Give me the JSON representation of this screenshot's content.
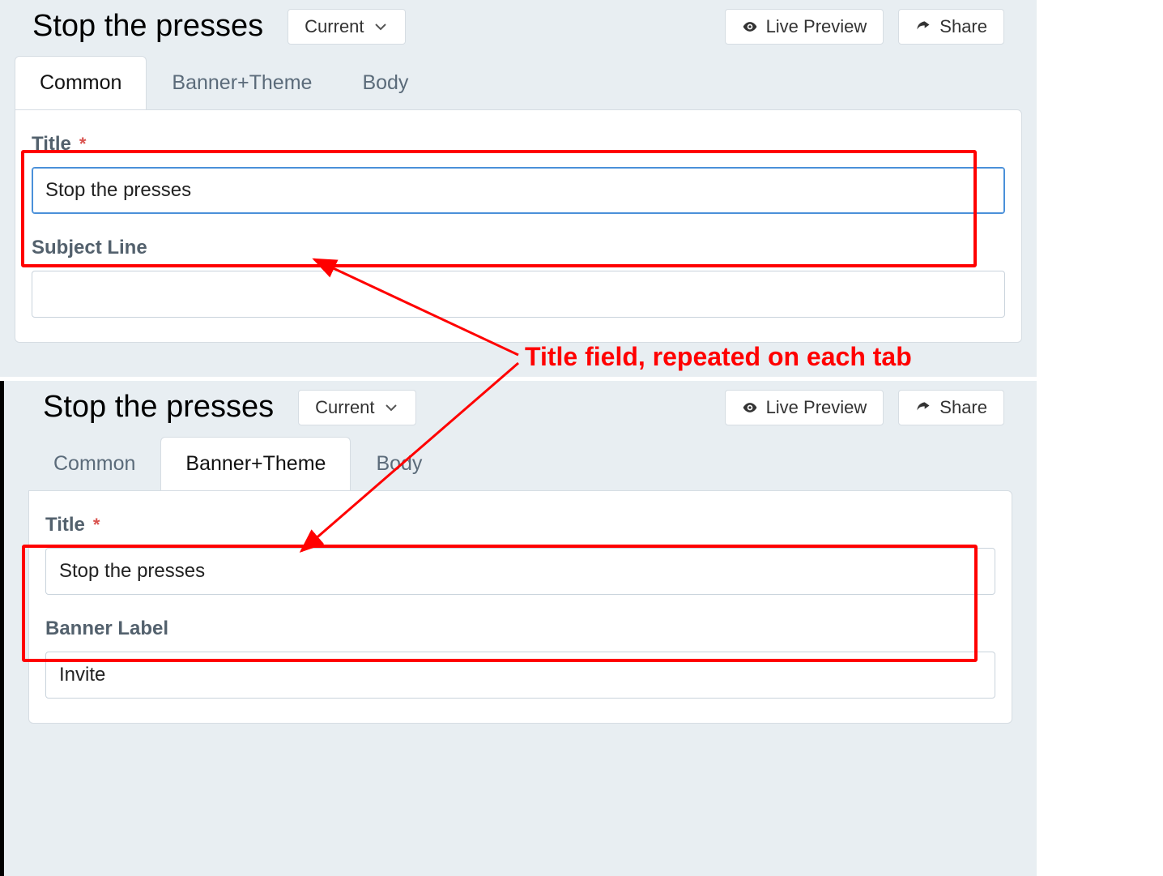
{
  "panel1": {
    "page_title": "Stop the presses",
    "version_btn": "Current",
    "preview_btn": "Live Preview",
    "share_btn": "Share",
    "tabs": [
      "Common",
      "Banner+Theme",
      "Body"
    ],
    "active_tab": 0,
    "title_label": "Title",
    "title_value": "Stop the presses",
    "subject_label": "Subject Line",
    "subject_value": ""
  },
  "panel2": {
    "page_title": "Stop the presses",
    "version_btn": "Current",
    "preview_btn": "Live Preview",
    "share_btn": "Share",
    "tabs": [
      "Common",
      "Banner+Theme",
      "Body"
    ],
    "active_tab": 1,
    "title_label": "Title",
    "title_value": "Stop the presses",
    "banner_label": "Banner Label",
    "banner_value": "Invite"
  },
  "annotation": "Title field, repeated on each tab",
  "required_mark": "*"
}
